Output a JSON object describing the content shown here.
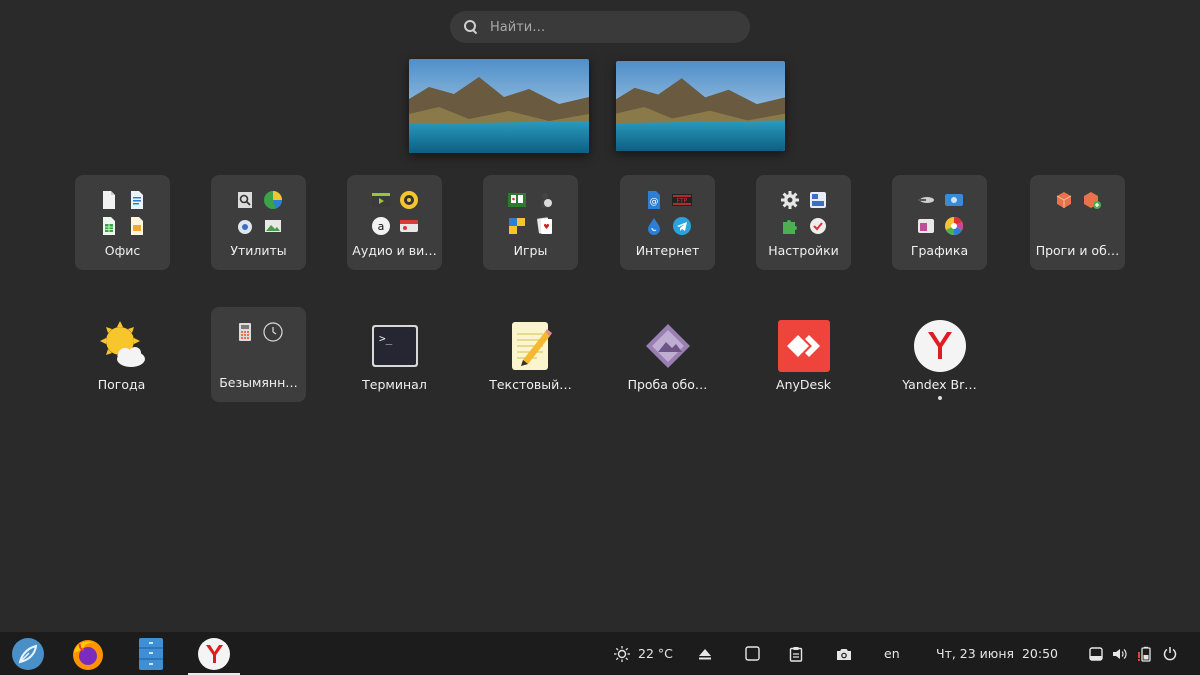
{
  "search": {
    "placeholder": "Найти…"
  },
  "workspaces": [
    {
      "name": "Workspace 1"
    },
    {
      "name": "Workspace 2"
    }
  ],
  "folders": [
    {
      "label": "Офис",
      "icons": [
        "document-icon",
        "writer-icon",
        "spreadsheet-icon",
        "draw-icon"
      ]
    },
    {
      "label": "Утилиты",
      "icons": [
        "document-viewer-icon",
        "disk-usage-icon",
        "settings-tool-icon",
        "image-viewer-icon"
      ]
    },
    {
      "label": "Аудио и ви…",
      "icons": [
        "video-editor-icon",
        "rhythmbox-icon",
        "audacity-icon",
        "recorder-icon"
      ]
    },
    {
      "label": "Игры",
      "icons": [
        "solitaire-icon",
        "chess-icon",
        "puzzle-icon",
        "cards-icon"
      ]
    },
    {
      "label": "Интернет",
      "icons": [
        "email-icon",
        "ftp-icon",
        "torrent-icon",
        "telegram-icon"
      ]
    },
    {
      "label": "Настройки",
      "icons": [
        "gear-icon",
        "panel-icon",
        "extensions-icon",
        "update-icon"
      ]
    },
    {
      "label": "Графика",
      "icons": [
        "scanner-icon",
        "screenshot-icon",
        "paint-icon",
        "color-picker-icon"
      ]
    },
    {
      "label": "Проги и об…",
      "icons": [
        "package-icon",
        "package-install-icon"
      ]
    }
  ],
  "apps": [
    {
      "label": "Погода"
    },
    {
      "label": "Безымянн…",
      "icons": [
        "calculator-icon",
        "clock-icon"
      ]
    },
    {
      "label": "Терминал"
    },
    {
      "label": "Текстовый…"
    },
    {
      "label": "Проба обо…"
    },
    {
      "label": "AnyDesk"
    },
    {
      "label": "Yandex Br…"
    }
  ],
  "taskbar": {
    "apps": [
      "menu-icon",
      "firefox-icon",
      "files-icon",
      "yandex-browser-icon"
    ],
    "weather": "22 °C",
    "keyboard": "en",
    "datetime": "Чт, 23 июня  20:50"
  },
  "colors": {
    "background": "#2a2a2a",
    "folder": "#3d3d3d",
    "taskbar": "#1c1c1c",
    "anydesk": "#ef443b",
    "yandex": "#e11b22"
  }
}
